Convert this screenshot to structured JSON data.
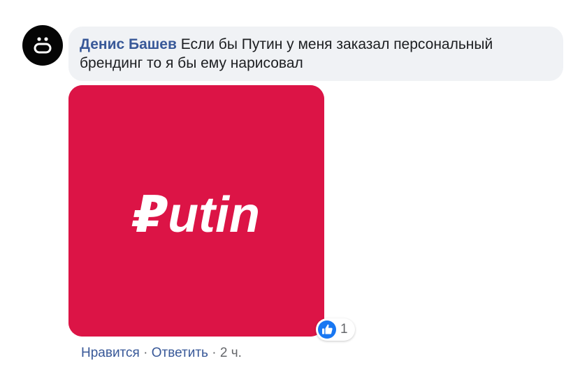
{
  "comment": {
    "author": "Денис Башев",
    "text": "Если бы Путин у меня заказал персональный брендинг то я бы ему нарисовал",
    "avatar_icon": "emoticon-face-icon",
    "attachment": {
      "brand_text": "₽utin",
      "background_color": "#dc1446",
      "text_color": "#ffffff"
    },
    "reactions": {
      "icon": "thumbs-up-icon",
      "count": "1",
      "color": "#1877f2"
    },
    "actions": {
      "like_label": "Нравится",
      "reply_label": "Ответить",
      "separator": "·",
      "timestamp": "2 ч."
    }
  },
  "colors": {
    "author_link": "#385898",
    "bubble_bg": "#f0f2f5",
    "meta_text": "#65676b"
  }
}
